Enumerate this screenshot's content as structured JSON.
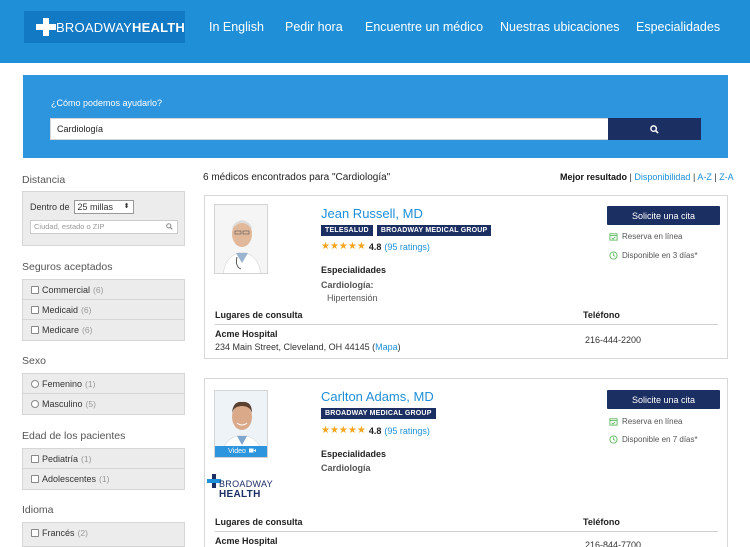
{
  "header": {
    "logo_light": "BROADWAY",
    "logo_bold": "HEALTH",
    "nav": [
      "In English",
      "Pedir hora",
      "Encuentre un médico",
      "Nuestras ubicaciones",
      "Especialidades"
    ]
  },
  "search": {
    "label": "¿Cómo podemos ayudarlo?",
    "value": "Cardiología"
  },
  "sidebar": {
    "distance": {
      "title": "Distancia",
      "within_label": "Dentro de",
      "within_value": "25 millas",
      "location_placeholder": "Ciudad, estado o ZIP"
    },
    "insurance": {
      "title": "Seguros aceptados",
      "options": [
        {
          "label": "Commercial",
          "count": "(6)"
        },
        {
          "label": "Medicaid",
          "count": "(6)"
        },
        {
          "label": "Medicare",
          "count": "(6)"
        }
      ]
    },
    "sex": {
      "title": "Sexo",
      "options": [
        {
          "label": "Femenino",
          "count": "(1)"
        },
        {
          "label": "Masculino",
          "count": "(5)"
        }
      ]
    },
    "age": {
      "title": "Edad de los pacientes",
      "options": [
        {
          "label": "Pediatría",
          "count": "(1)"
        },
        {
          "label": "Adolescentes",
          "count": "(1)"
        }
      ]
    },
    "language": {
      "title": "Idioma",
      "options": [
        {
          "label": "Francés",
          "count": "(2)"
        }
      ]
    }
  },
  "results": {
    "count_text": "6 médicos encontrados para  \"Cardiología\"",
    "sort": {
      "best": "Mejor resultado",
      "availability": "Disponibilidad",
      "az": "A-Z",
      "za": "Z-A",
      "sep": "|"
    }
  },
  "doctors": [
    {
      "name": "Jean Russell, MD",
      "badges": [
        "TELESALUD",
        "BROADWAY MEDICAL GROUP"
      ],
      "stars": "★★★★★",
      "score": "4.8",
      "ratings": "(95 ratings)",
      "specialties_title": "Especialidades",
      "specialty": "Cardiología:",
      "subspecialty": "Hipertensión",
      "cta": "Solicite una cita",
      "online": "Reserva en línea",
      "available": "Disponible en 3 días*",
      "locations_title": "Lugares de consulta",
      "phone_title": "Teléfono",
      "location_name": "Acme Hospital",
      "address": "234 Main Street, Cleveland, OH 44145 (",
      "map": "Mapa",
      "address_end": ")",
      "phone": "216-444-2200"
    },
    {
      "name": "Carlton Adams, MD",
      "badges": [
        "BROADWAY MEDICAL GROUP"
      ],
      "stars": "★★★★★",
      "score": "4.8",
      "ratings": "(95 ratings)",
      "specialties_title": "Especialidades",
      "specialty": "Cardiología",
      "video": "Video",
      "brand_light": "BROADWAY",
      "brand_bold": "HEALTH",
      "cta": "Solicite una cita",
      "online": "Reserva en línea",
      "available": "Disponible en 7 días*",
      "locations_title": "Lugares de consulta",
      "phone_title": "Teléfono",
      "location_name": "Acme Hospital",
      "phone": "216-844-7700"
    }
  ],
  "colors": {
    "header": "#1f8fd8",
    "navy": "#1c2f63",
    "link": "#1f8fd8",
    "star": "#f3a51d",
    "green": "#5cb85c"
  }
}
